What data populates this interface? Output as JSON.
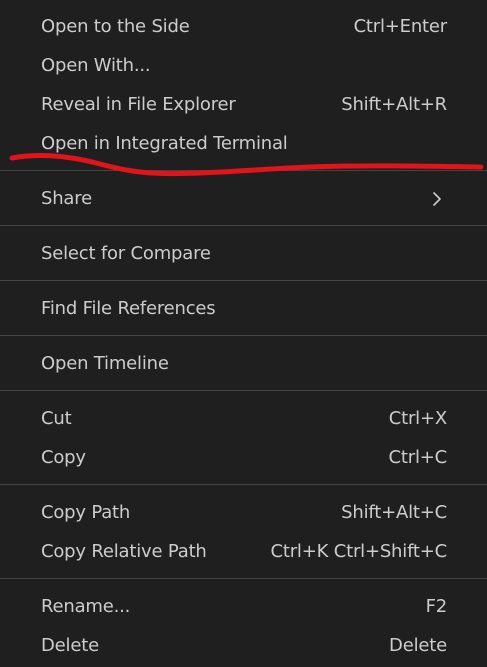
{
  "menu": {
    "items": [
      {
        "label": "Open to the Side",
        "shortcut": "Ctrl+Enter"
      },
      {
        "label": "Open With...",
        "shortcut": ""
      },
      {
        "label": "Reveal in File Explorer",
        "shortcut": "Shift+Alt+R"
      },
      {
        "label": "Open in Integrated Terminal",
        "shortcut": ""
      },
      {
        "label": "Share",
        "shortcut": ""
      },
      {
        "label": "Select for Compare",
        "shortcut": ""
      },
      {
        "label": "Find File References",
        "shortcut": ""
      },
      {
        "label": "Open Timeline",
        "shortcut": ""
      },
      {
        "label": "Cut",
        "shortcut": "Ctrl+X"
      },
      {
        "label": "Copy",
        "shortcut": "Ctrl+C"
      },
      {
        "label": "Copy Path",
        "shortcut": "Shift+Alt+C"
      },
      {
        "label": "Copy Relative Path",
        "shortcut": "Ctrl+K Ctrl+Shift+C"
      },
      {
        "label": "Rename...",
        "shortcut": "F2"
      },
      {
        "label": "Delete",
        "shortcut": "Delete"
      }
    ]
  },
  "colors": {
    "background": "#1f1f1f",
    "text": "#cccccc",
    "separator": "#454545",
    "annotation": "#e0141a"
  },
  "icons": {
    "share_submenu": "chevron-right-icon"
  }
}
